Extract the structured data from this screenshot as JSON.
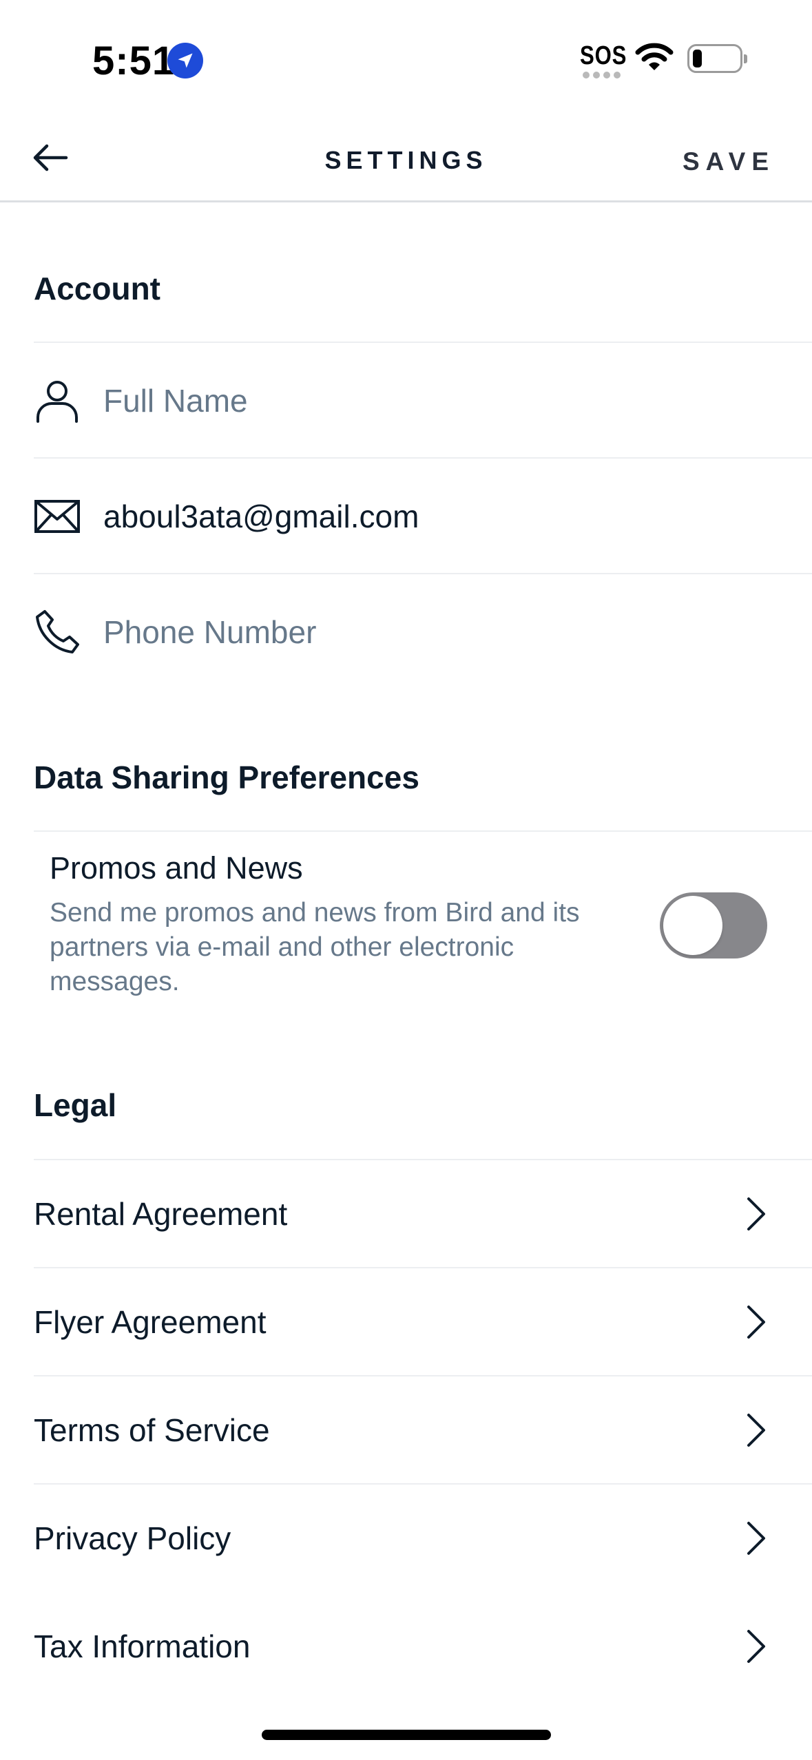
{
  "status_bar": {
    "time": "5:51",
    "sos": "SOS"
  },
  "header": {
    "title": "SETTINGS",
    "save_label": "SAVE"
  },
  "account": {
    "title": "Account",
    "full_name": {
      "value": "",
      "placeholder": "Full Name",
      "icon": "user-icon"
    },
    "email": {
      "value": "aboul3ata@gmail.com",
      "placeholder": "",
      "icon": "mail-icon"
    },
    "phone": {
      "value": "",
      "placeholder": "Phone Number",
      "icon": "phone-icon"
    }
  },
  "data_sharing": {
    "title": "Data Sharing Preferences",
    "promos": {
      "title": "Promos and News",
      "description": "Send me promos and news from Bird and its partners via e-mail and other electronic messages.",
      "enabled": false
    }
  },
  "legal": {
    "title": "Legal",
    "items": [
      {
        "label": "Rental Agreement"
      },
      {
        "label": "Flyer Agreement"
      },
      {
        "label": "Terms of Service"
      },
      {
        "label": "Privacy Policy"
      },
      {
        "label": "Tax Information"
      }
    ]
  },
  "colors": {
    "text_primary": "#0d1b2a",
    "text_secondary": "#66788a",
    "toggle_off": "#87878b",
    "location_badge": "#1e4bd8"
  }
}
